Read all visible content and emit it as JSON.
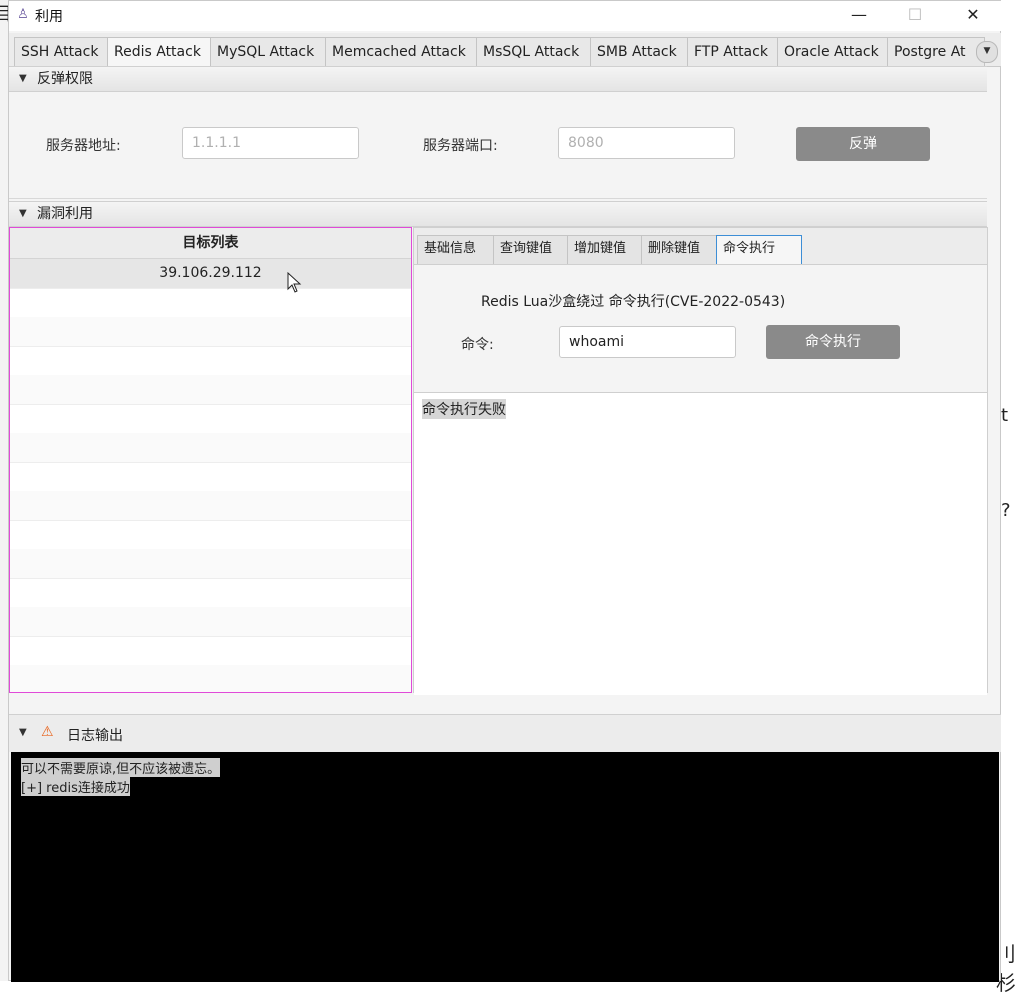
{
  "window": {
    "title": "利用",
    "min": "—",
    "max": "☐",
    "close": "✕"
  },
  "tabs": [
    {
      "label": "SSH Attack",
      "active": false
    },
    {
      "label": "Redis Attack",
      "active": true
    },
    {
      "label": "MySQL Attack",
      "active": false
    },
    {
      "label": "Memcached Attack",
      "active": false
    },
    {
      "label": "MsSQL Attack",
      "active": false
    },
    {
      "label": "SMB Attack",
      "active": false
    },
    {
      "label": "FTP Attack",
      "active": false
    },
    {
      "label": "Oracle Attack",
      "active": false
    },
    {
      "label": "Postgre At",
      "active": false
    }
  ],
  "reverse": {
    "section_title": "反弹权限",
    "server_addr_label": "服务器地址:",
    "server_addr_placeholder": "1.1.1.1",
    "server_port_label": "服务器端口:",
    "server_port_placeholder": "8080",
    "button": "反弹"
  },
  "exploit": {
    "section_title": "漏洞利用",
    "targets_header": "目标列表",
    "targets": [
      "39.106.29.112"
    ],
    "subtabs": [
      "基础信息",
      "查询键值",
      "增加键值",
      "删除键值",
      "命令执行"
    ],
    "active_subtab": 4,
    "vuln_title": "Redis Lua沙盒绕过 命令执行(CVE-2022-0543)",
    "cmd_label": "命令:",
    "cmd_value": "whoami",
    "cmd_button": "命令执行",
    "result": "命令执行失败"
  },
  "log": {
    "section_title": "日志输出",
    "lines": [
      "可以不需要原谅,但不应该被遗忘。",
      "[+] redis连接成功"
    ]
  },
  "background": {
    "left_char": "目",
    "right_char_1": "t",
    "right_char_2": "?",
    "right_char_3": "刂杉"
  }
}
